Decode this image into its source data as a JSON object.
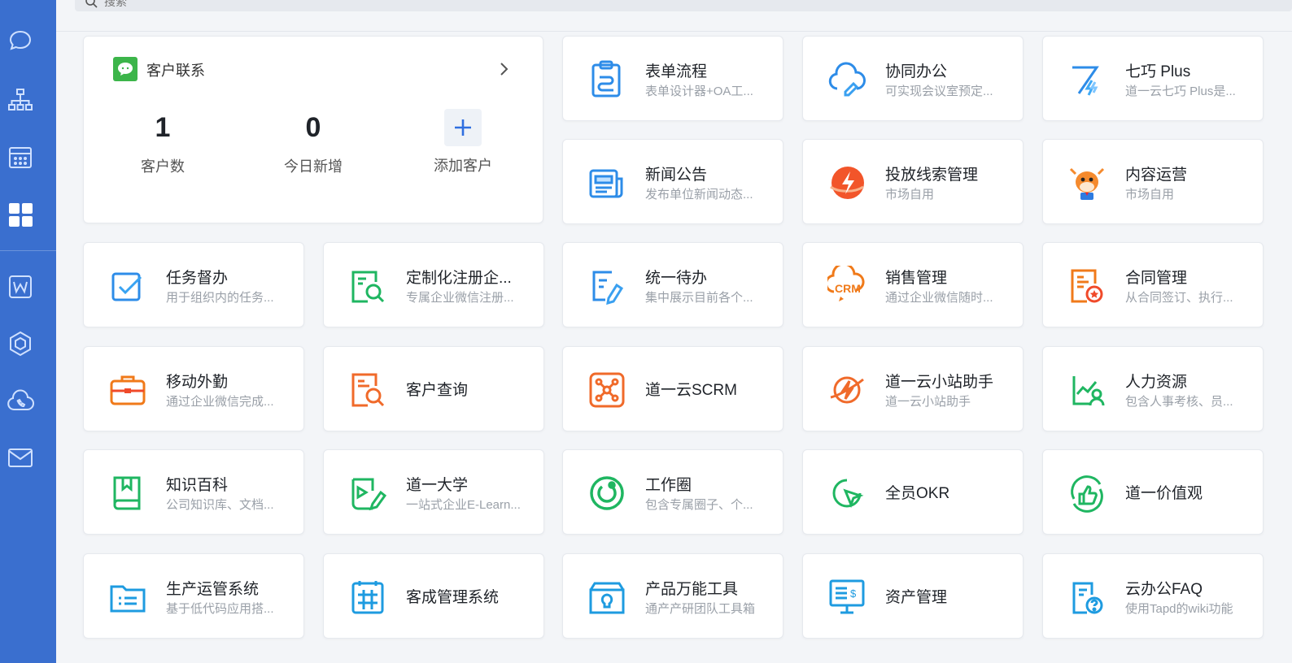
{
  "search": {
    "placeholder": "搜索"
  },
  "sidebar": {
    "items": [
      {
        "icon": "chat-icon"
      },
      {
        "icon": "org-structure-icon"
      },
      {
        "icon": "calendar-icon"
      },
      {
        "icon": "workbench-grid-icon",
        "active": true
      },
      {
        "icon": "word-document-icon"
      },
      {
        "icon": "cube-icon"
      },
      {
        "icon": "cloud-phone-icon"
      },
      {
        "icon": "mail-icon"
      }
    ]
  },
  "customer_contact": {
    "title": "客户联系",
    "stats": [
      {
        "value": "1",
        "label": "客户数"
      },
      {
        "value": "0",
        "label": "今日新增"
      }
    ],
    "add_label": "添加客户"
  },
  "apps": [
    {
      "title": "表单流程",
      "desc": "表单设计器+OA工...",
      "icon": "form-flow-icon"
    },
    {
      "title": "协同办公",
      "desc": "可实现会议室预定...",
      "icon": "cloud-collab-icon"
    },
    {
      "title": "七巧 Plus",
      "desc": "道一云七巧 Plus是...",
      "icon": "qiqiao-plus-icon"
    },
    {
      "title": "新闻公告",
      "desc": "发布单位新闻动态...",
      "icon": "news-icon"
    },
    {
      "title": "投放线索管理",
      "desc": "市场自用",
      "icon": "lightning-leads-icon"
    },
    {
      "title": "内容运营",
      "desc": "市场自用",
      "icon": "cow-mascot-icon"
    },
    {
      "title": "任务督办",
      "desc": "用于组织内的任务...",
      "icon": "task-check-icon"
    },
    {
      "title": "定制化注册企...",
      "desc": "专属企业微信注册...",
      "icon": "custom-register-icon"
    },
    {
      "title": "统一待办",
      "desc": "集中展示目前各个...",
      "icon": "todo-pin-icon"
    },
    {
      "title": "销售管理",
      "desc": "通过企业微信随时...",
      "icon": "crm-sales-icon"
    },
    {
      "title": "合同管理",
      "desc": "从合同签订、执行...",
      "icon": "contract-icon"
    },
    {
      "title": "移动外勤",
      "desc": "通过企业微信完成...",
      "icon": "briefcase-icon"
    },
    {
      "title": "客户查询",
      "desc": "",
      "icon": "customer-search-icon"
    },
    {
      "title": "道一云SCRM",
      "desc": "",
      "icon": "scrm-network-icon"
    },
    {
      "title": "道一云小站助手",
      "desc": "道一云小站助手",
      "icon": "planet-bolt-icon"
    },
    {
      "title": "人力资源",
      "desc": "包含人事考核、员...",
      "icon": "hr-chart-icon"
    },
    {
      "title": "知识百科",
      "desc": "公司知识库、文档...",
      "icon": "knowledge-book-icon"
    },
    {
      "title": "道一大学",
      "desc": "一站式企业E-Learn...",
      "icon": "elearning-icon"
    },
    {
      "title": "工作圈",
      "desc": "包含专属圈子、个...",
      "icon": "work-circle-icon"
    },
    {
      "title": "全员OKR",
      "desc": "",
      "icon": "okr-cursor-icon"
    },
    {
      "title": "道一价值观",
      "desc": "",
      "icon": "values-thumb-icon"
    },
    {
      "title": "生产运管系统",
      "desc": "基于低代码应用搭...",
      "icon": "production-folder-icon"
    },
    {
      "title": "客成管理系统",
      "desc": "",
      "icon": "customer-success-icon"
    },
    {
      "title": "产品万能工具",
      "desc": "通产产研团队工具箱",
      "icon": "product-toolbox-icon"
    },
    {
      "title": "资产管理",
      "desc": "",
      "icon": "asset-monitor-icon"
    },
    {
      "title": "云办公FAQ",
      "desc": "使用Tapd的wiki功能",
      "icon": "faq-icon"
    }
  ]
}
